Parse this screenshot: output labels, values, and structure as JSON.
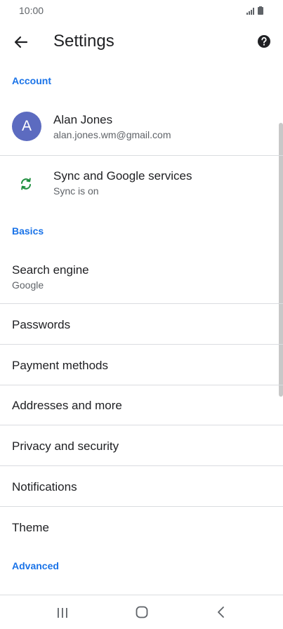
{
  "status_bar": {
    "time": "10:00"
  },
  "app_bar": {
    "title": "Settings"
  },
  "sections": {
    "account": "Account",
    "basics": "Basics",
    "advanced": "Advanced"
  },
  "account": {
    "avatar_initial": "A",
    "name": "Alan Jones",
    "email": "alan.jones.wm@gmail.com",
    "avatar_color": "#5c6bc0"
  },
  "sync": {
    "title": "Sync and Google services",
    "subtitle": "Sync is on",
    "icon_color": "#1e8e3e"
  },
  "basics": {
    "search_engine": {
      "title": "Search engine",
      "value": "Google"
    },
    "passwords": "Passwords",
    "payment_methods": "Payment methods",
    "addresses": "Addresses and more",
    "privacy": "Privacy and security",
    "notifications": "Notifications",
    "theme": "Theme"
  },
  "colors": {
    "accent": "#1a73e8",
    "divider": "#dadce0"
  }
}
